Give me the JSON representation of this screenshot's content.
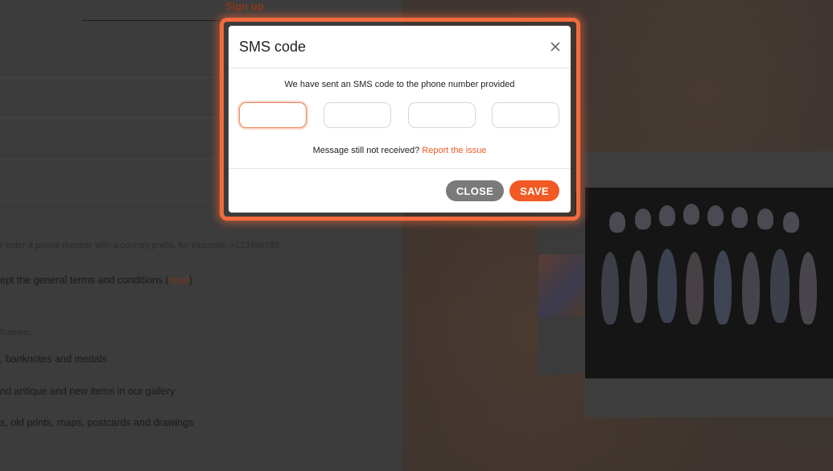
{
  "background": {
    "signup_tab": "Sign up",
    "phone_hint": "r enter a phone number with a country prefix, for example: +123456789",
    "terms_prefix": "ept the general terms and conditions (",
    "terms_read": "read",
    "terms_suffix": ")",
    "notifications_label": "fications:",
    "notification_items": [
      ", banknotes and medals",
      "nd antique and new items in our gallery",
      "s, old prints, maps, postcards and drawings"
    ]
  },
  "modal": {
    "title": "SMS code",
    "close_icon": "close-icon",
    "message": "We have sent an SMS code to the phone number provided",
    "code_inputs": [
      "",
      "",
      "",
      ""
    ],
    "not_received": "Message still not received?",
    "report_link": "Report the issue",
    "close_button": "CLOSE",
    "save_button": "SAVE"
  },
  "colors": {
    "accent": "#f15a24",
    "highlight_frame": "#f26a3d",
    "close_button_bg": "#7a7a7a"
  }
}
